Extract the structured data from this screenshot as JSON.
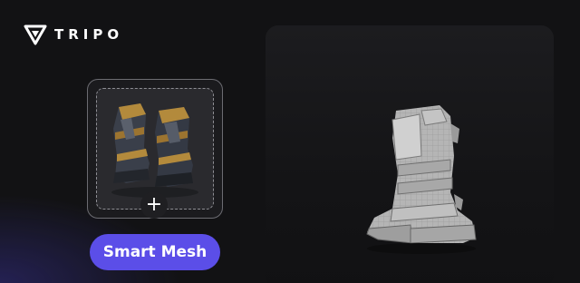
{
  "brand": {
    "name": "TRIPO",
    "logo_icon": "tripo-logo-icon"
  },
  "upload": {
    "image_alt": "armored boots",
    "add_icon": "plus-icon",
    "add_symbol": "+"
  },
  "actions": {
    "primary_label": "Smart Mesh",
    "accent_color": "#5b4ee8"
  },
  "viewer": {
    "model": "mesh-boot"
  }
}
